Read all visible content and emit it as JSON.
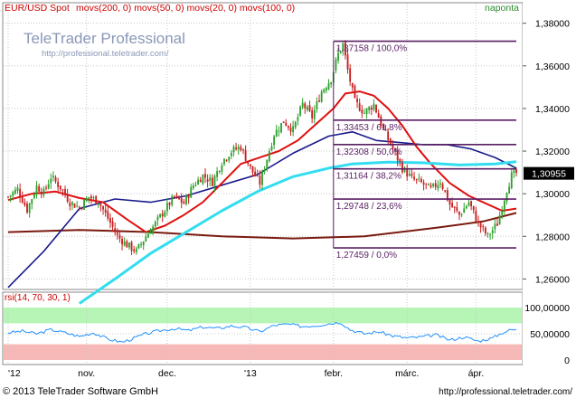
{
  "app": {
    "header_title": "EUR/USD Spot",
    "header_studies": "movs(200, 0) movs(50, 0) movs(20, 0) movs(100, 0)",
    "period": "naponta",
    "watermark_title": "TeleTrader Professional",
    "watermark_url": "http://professional.teletrader.com/",
    "footer_copyright": "© 2013 TeleTrader Software GmbH",
    "footer_url": "http://professional.teletrader.com/",
    "rsi_label": "rsi(14, 70, 30, 1)"
  },
  "colors": {
    "background": "#ffffff",
    "up_candle": "#2ca02c",
    "down_candle": "#c81e1e",
    "ma200": "#7a1a10",
    "ma50": "#1a1a8c",
    "ma20": "#e01010",
    "ma100": "#33ddf0",
    "fib_lines": "#5a1e64",
    "rsi_line": "#1e90ff",
    "rsi_upper_zone": "#b6f5b6",
    "rsi_lower_zone": "#f7b8b8",
    "grid": "#c8c8c8",
    "price_badge": "#000000"
  },
  "chart_data": {
    "type": "candlestick",
    "title": "EUR/USD Spot",
    "interval": "naponta",
    "y_ticks": [
      "1,26000",
      "1,28000",
      "1,30000",
      "1,32000",
      "1,34000",
      "1,36000",
      "1,38000"
    ],
    "ylim": [
      1.2555,
      1.3892
    ],
    "x_tick_labels": [
      "'12",
      "nov.",
      "dec.",
      "'13",
      "febr.",
      "márc.",
      "ápr."
    ],
    "last_price": "1,30955",
    "last_price_value": 1.30955,
    "close_path": [
      [
        0,
        1.2985
      ],
      [
        4,
        1.3022
      ],
      [
        8,
        1.2925
      ],
      [
        12,
        1.3035
      ],
      [
        15,
        1.3005
      ],
      [
        18,
        1.308
      ],
      [
        22,
        1.303
      ],
      [
        26,
        1.296
      ],
      [
        30,
        1.2935
      ],
      [
        34,
        1.2985
      ],
      [
        38,
        1.2965
      ],
      [
        42,
        1.2885
      ],
      [
        46,
        1.28
      ],
      [
        50,
        1.276
      ],
      [
        54,
        1.273
      ],
      [
        58,
        1.28
      ],
      [
        62,
        1.286
      ],
      [
        66,
        1.2925
      ],
      [
        70,
        1.2985
      ],
      [
        74,
        1.2955
      ],
      [
        78,
        1.304
      ],
      [
        82,
        1.3085
      ],
      [
        86,
        1.3055
      ],
      [
        90,
        1.315
      ],
      [
        94,
        1.32
      ],
      [
        98,
        1.322
      ],
      [
        102,
        1.312
      ],
      [
        106,
        1.305
      ],
      [
        109,
        1.3165
      ],
      [
        112,
        1.328
      ],
      [
        116,
        1.334
      ],
      [
        120,
        1.33
      ],
      [
        124,
        1.342
      ],
      [
        128,
        1.336
      ],
      [
        132,
        1.348
      ],
      [
        136,
        1.354
      ],
      [
        139,
        1.3655
      ],
      [
        141,
        1.37
      ],
      [
        143,
        1.358
      ],
      [
        146,
        1.343
      ],
      [
        150,
        1.338
      ],
      [
        154,
        1.342
      ],
      [
        158,
        1.33
      ],
      [
        162,
        1.321
      ],
      [
        166,
        1.312
      ],
      [
        170,
        1.307
      ],
      [
        174,
        1.305
      ],
      [
        178,
        1.302
      ],
      [
        182,
        1.306
      ],
      [
        186,
        1.295
      ],
      [
        190,
        1.29
      ],
      [
        194,
        1.296
      ],
      [
        198,
        1.286
      ],
      [
        202,
        1.28
      ],
      [
        206,
        1.286
      ],
      [
        208,
        1.294
      ],
      [
        210,
        1.302
      ],
      [
        212,
        1.3085
      ],
      [
        214,
        1.3096
      ]
    ],
    "series": [
      {
        "name": "movs(200, 0)",
        "points": [
          [
            0,
            1.282
          ],
          [
            30,
            1.283
          ],
          [
            60,
            1.282
          ],
          [
            90,
            1.28
          ],
          [
            120,
            1.279
          ],
          [
            150,
            1.28
          ],
          [
            180,
            1.284
          ],
          [
            200,
            1.287
          ],
          [
            214,
            1.291
          ]
        ]
      },
      {
        "name": "movs(50, 0)",
        "points": [
          [
            0,
            1.256
          ],
          [
            15,
            1.273
          ],
          [
            30,
            1.293
          ],
          [
            45,
            1.2975
          ],
          [
            60,
            1.296
          ],
          [
            75,
            1.299
          ],
          [
            90,
            1.304
          ],
          [
            105,
            1.309
          ],
          [
            120,
            1.319
          ],
          [
            135,
            1.327
          ],
          [
            145,
            1.329
          ],
          [
            155,
            1.325
          ],
          [
            165,
            1.324
          ],
          [
            175,
            1.323
          ],
          [
            185,
            1.323
          ],
          [
            195,
            1.321
          ],
          [
            205,
            1.317
          ],
          [
            214,
            1.312
          ]
        ]
      },
      {
        "name": "movs(20, 0)",
        "points": [
          [
            0,
            1.297
          ],
          [
            10,
            1.3
          ],
          [
            20,
            1.301
          ],
          [
            30,
            1.298
          ],
          [
            40,
            1.296
          ],
          [
            50,
            1.288
          ],
          [
            58,
            1.282
          ],
          [
            66,
            1.285
          ],
          [
            74,
            1.29
          ],
          [
            82,
            1.296
          ],
          [
            90,
            1.305
          ],
          [
            98,
            1.314
          ],
          [
            106,
            1.317
          ],
          [
            114,
            1.32
          ],
          [
            122,
            1.325
          ],
          [
            130,
            1.333
          ],
          [
            137,
            1.34
          ],
          [
            142,
            1.347
          ],
          [
            148,
            1.348
          ],
          [
            154,
            1.346
          ],
          [
            160,
            1.34
          ],
          [
            166,
            1.332
          ],
          [
            172,
            1.322
          ],
          [
            178,
            1.314
          ],
          [
            186,
            1.305
          ],
          [
            194,
            1.299
          ],
          [
            202,
            1.295
          ],
          [
            208,
            1.292
          ],
          [
            214,
            1.293
          ]
        ]
      },
      {
        "name": "movs(100, 0)",
        "points": [
          [
            30,
            1.2485
          ],
          [
            45,
            1.26
          ],
          [
            60,
            1.272
          ],
          [
            75,
            1.282
          ],
          [
            90,
            1.292
          ],
          [
            105,
            1.301
          ],
          [
            120,
            1.308
          ],
          [
            135,
            1.312
          ],
          [
            145,
            1.314
          ],
          [
            160,
            1.3148
          ],
          [
            175,
            1.3145
          ],
          [
            190,
            1.3135
          ],
          [
            205,
            1.314
          ],
          [
            214,
            1.315
          ]
        ]
      }
    ],
    "fibonacci": [
      {
        "label": "1,37158 / 100,0%",
        "value": 1.37158
      },
      {
        "label": "1,33453 / 61,8%",
        "value": 1.33453
      },
      {
        "label": "1,32308 / 50,0%",
        "value": 1.32308
      },
      {
        "label": "1,31164 / 38,2%",
        "value": 1.31164
      },
      {
        "label": "1,29748 / 23,6%",
        "value": 1.29748
      },
      {
        "label": "1,27459 / 0,0%",
        "value": 1.27459
      }
    ],
    "fib_x_range": [
      137,
      214
    ],
    "rsi": {
      "name": "rsi(14, 70, 30, 1)",
      "y_ticks": [
        "100,00000",
        "50,00000",
        "0"
      ],
      "ylim": [
        0,
        100
      ],
      "upper_band": 70,
      "lower_band": 30,
      "points": [
        [
          0,
          52
        ],
        [
          6,
          55
        ],
        [
          12,
          50
        ],
        [
          18,
          58
        ],
        [
          24,
          52
        ],
        [
          30,
          45
        ],
        [
          36,
          52
        ],
        [
          42,
          40
        ],
        [
          48,
          34
        ],
        [
          52,
          40
        ],
        [
          58,
          50
        ],
        [
          64,
          56
        ],
        [
          70,
          60
        ],
        [
          76,
          56
        ],
        [
          82,
          63
        ],
        [
          88,
          60
        ],
        [
          94,
          65
        ],
        [
          100,
          62
        ],
        [
          106,
          54
        ],
        [
          112,
          66
        ],
        [
          118,
          68
        ],
        [
          124,
          64
        ],
        [
          130,
          66
        ],
        [
          136,
          70
        ],
        [
          140,
          72
        ],
        [
          144,
          58
        ],
        [
          150,
          50
        ],
        [
          156,
          54
        ],
        [
          162,
          46
        ],
        [
          168,
          42
        ],
        [
          174,
          44
        ],
        [
          180,
          48
        ],
        [
          186,
          38
        ],
        [
          192,
          44
        ],
        [
          198,
          36
        ],
        [
          204,
          42
        ],
        [
          208,
          52
        ],
        [
          212,
          58
        ],
        [
          214,
          57
        ]
      ]
    }
  }
}
